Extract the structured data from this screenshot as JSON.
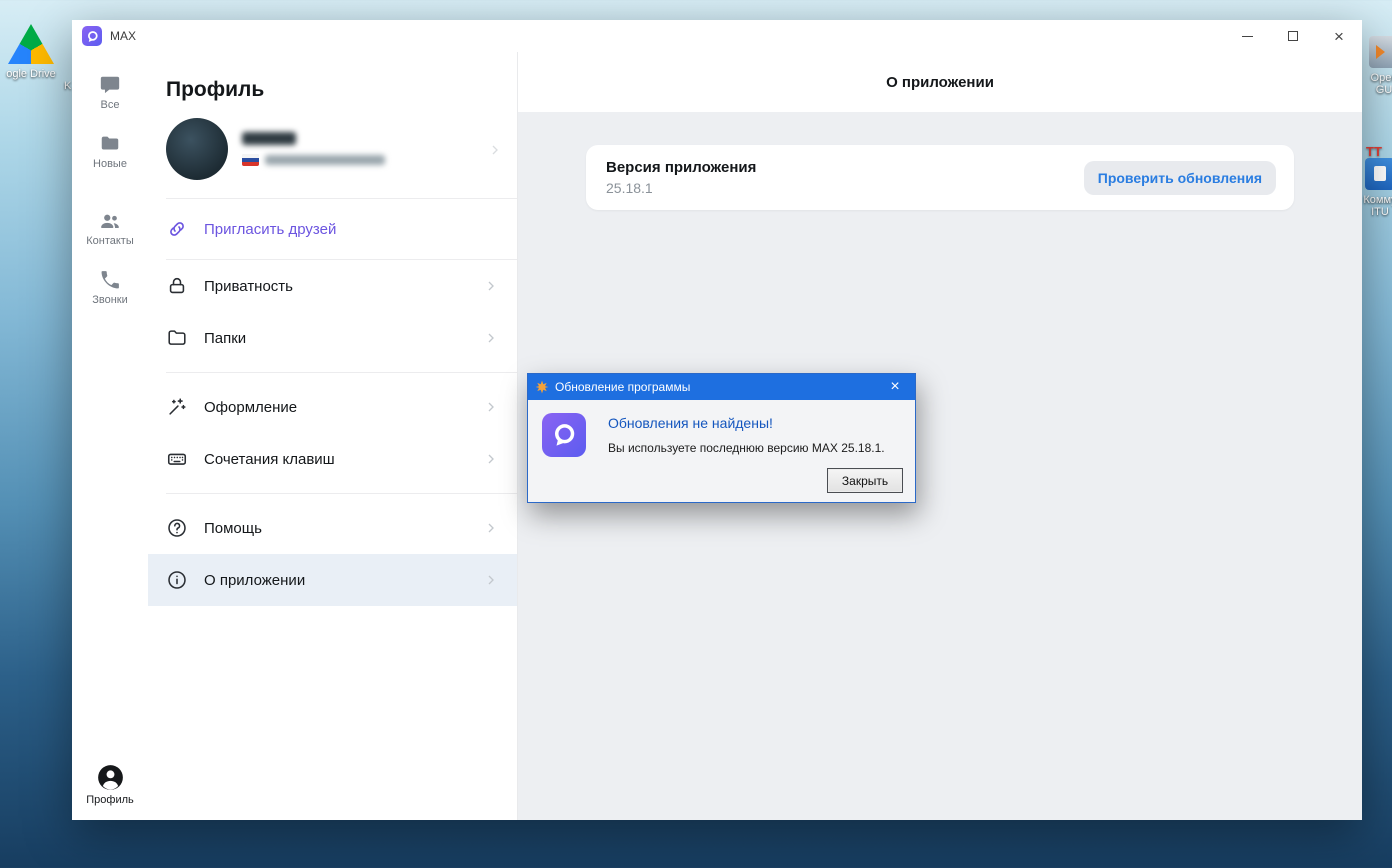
{
  "colors": {
    "accent_purple": "#6C55E0",
    "link_blue": "#2A7DE1",
    "dialog_title_blue": "#1E6FE0",
    "dialog_heading_blue": "#1456BE"
  },
  "desktop": {
    "left_icons": [
      {
        "label": "ogle Drive"
      },
      {
        "label": "K"
      }
    ],
    "right_icons": [
      {
        "label_line1": "Open",
        "label_line2": "GU"
      },
      {
        "label_line1": "Комму",
        "label_line2": "ITU"
      }
    ],
    "tt_label": "TT"
  },
  "window": {
    "title": "MAX"
  },
  "rail": {
    "items": [
      {
        "label": "Все"
      },
      {
        "label": "Новые"
      },
      {
        "label": "Контакты"
      },
      {
        "label": "Звонки"
      }
    ],
    "profile": {
      "label": "Профиль"
    }
  },
  "settings": {
    "title": "Профиль",
    "invite_label": "Пригласить друзей",
    "items": [
      {
        "label": "Приватность"
      },
      {
        "label": "Папки"
      },
      {
        "label": "Оформление"
      },
      {
        "label": "Сочетания клавиш"
      },
      {
        "label": "Помощь"
      },
      {
        "label": "О приложении"
      }
    ]
  },
  "main": {
    "title": "О приложении",
    "version_card": {
      "label": "Версия приложения",
      "value": "25.18.1",
      "button_label": "Проверить обновления"
    }
  },
  "dialog": {
    "title": "Обновление программы",
    "heading": "Обновления не найдены!",
    "body": "Вы используете последнюю версию MAX 25.18.1.",
    "close_button": "Закрыть"
  }
}
